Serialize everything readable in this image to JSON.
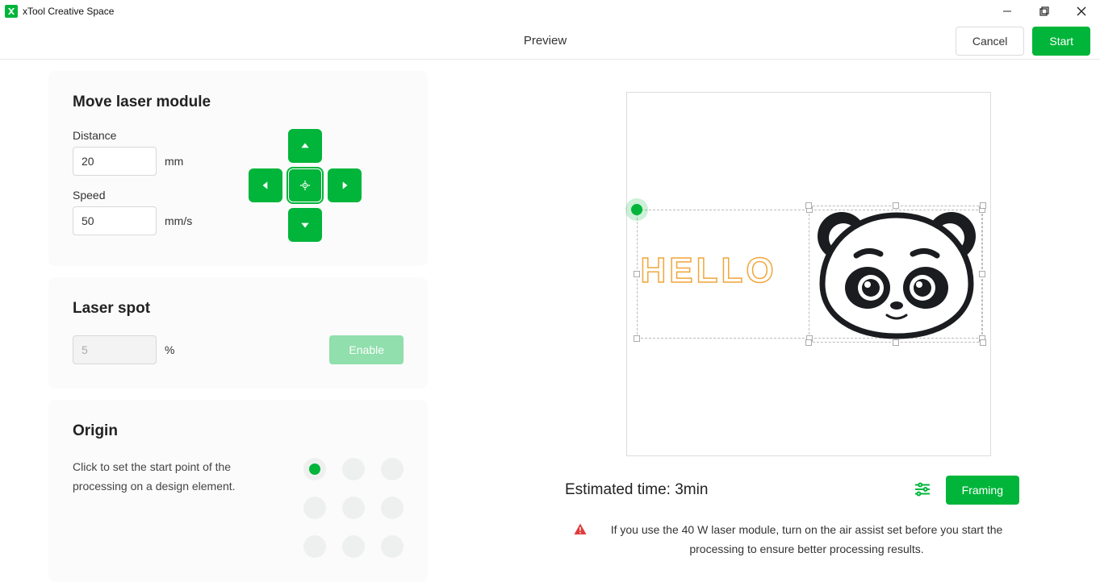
{
  "app": {
    "title": "xTool Creative Space"
  },
  "header": {
    "title": "Preview",
    "cancel": "Cancel",
    "start": "Start"
  },
  "move": {
    "title": "Move laser module",
    "distance_label": "Distance",
    "distance_value": "20",
    "distance_unit": "mm",
    "speed_label": "Speed",
    "speed_value": "50",
    "speed_unit": "mm/s"
  },
  "laser_spot": {
    "title": "Laser spot",
    "power_value": "5",
    "power_unit": "%",
    "enable_label": "Enable"
  },
  "origin": {
    "title": "Origin",
    "description": "Click to set the start point of the processing on a design element.",
    "active_index": 0
  },
  "preview": {
    "hello_text": "HELLO"
  },
  "footer": {
    "estimate": "Estimated time: 3min",
    "framing": "Framing",
    "warning": "If you use the 40 W laser module, turn on the air assist set before you start the processing to ensure better processing results."
  }
}
